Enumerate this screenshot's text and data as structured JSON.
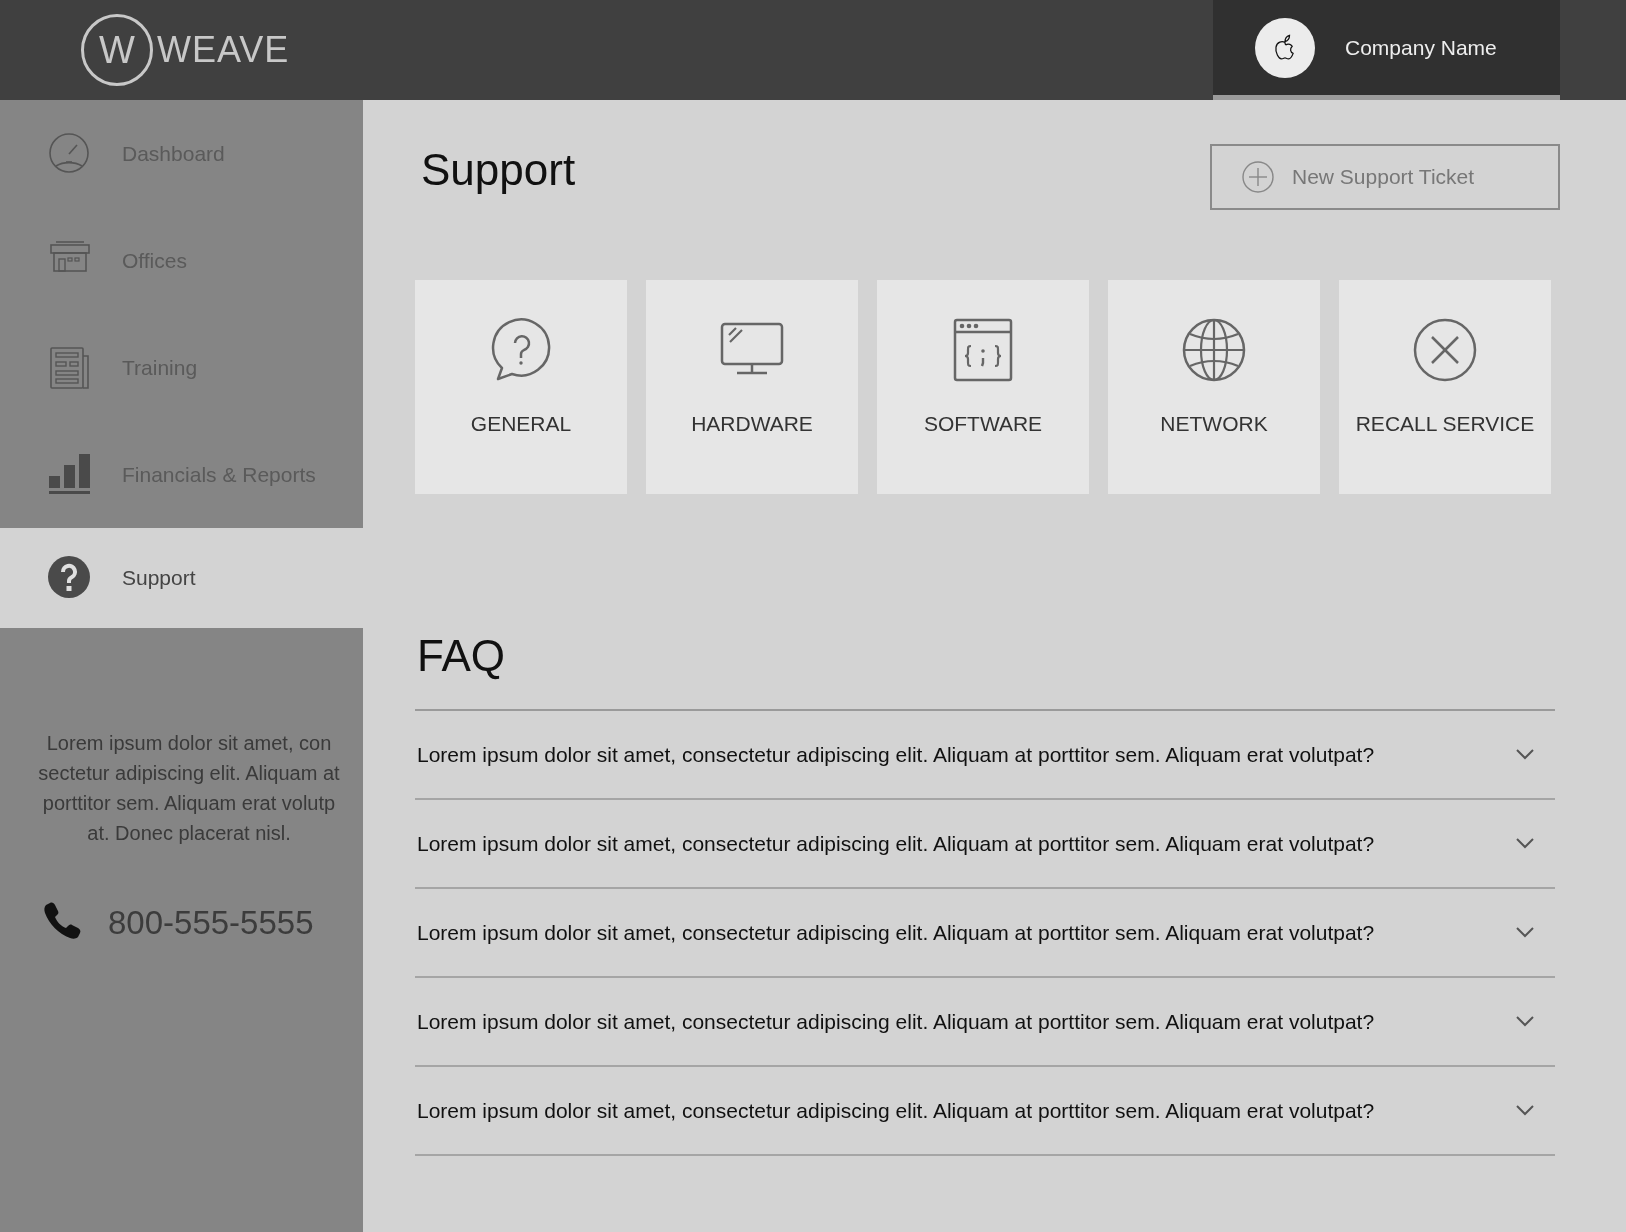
{
  "header": {
    "logo_text": "WEAVE",
    "logo_letter": "W",
    "company_name": "Company Name"
  },
  "sidebar": {
    "items": [
      {
        "label": "Dashboard",
        "selected": false
      },
      {
        "label": "Offices",
        "selected": false
      },
      {
        "label": "Training",
        "selected": false
      },
      {
        "label": "Financials & Reports",
        "selected": false
      },
      {
        "label": "Support",
        "selected": true
      }
    ],
    "blurb": "Lorem ipsum dolor sit amet, con sectetur adipiscing elit. Aliquam at porttitor sem. Aliquam erat volutp at. Donec placerat nisl.",
    "phone": "800-555-5555"
  },
  "page": {
    "title": "Support",
    "new_ticket_button": "New Support Ticket"
  },
  "categories": [
    {
      "label": "GENERAL"
    },
    {
      "label": "HARDWARE"
    },
    {
      "label": "SOFTWARE"
    },
    {
      "label": "NETWORK"
    },
    {
      "label": "RECALL SERVICE"
    }
  ],
  "faq": {
    "title": "FAQ",
    "items": [
      {
        "question": "Lorem ipsum dolor sit amet, consectetur adipiscing elit. Aliquam at porttitor sem. Aliquam erat volutpat?",
        "expanded": false
      },
      {
        "question": "Lorem ipsum dolor sit amet, consectetur adipiscing elit. Aliquam at porttitor sem. Aliquam erat volutpat?",
        "expanded": false
      },
      {
        "question": "Lorem ipsum dolor sit amet, consectetur adipiscing elit. Aliquam at porttitor sem. Aliquam erat volutpat?",
        "expanded": false
      },
      {
        "question": "Lorem ipsum dolor sit amet, consectetur adipiscing elit. Aliquam at porttitor sem. Aliquam erat volutpat?",
        "expanded": false
      },
      {
        "question": "Lorem ipsum dolor sit amet, consectetur adipiscing elit. Aliquam at porttitor sem. Aliquam erat volutpat?",
        "expanded": false
      }
    ]
  }
}
